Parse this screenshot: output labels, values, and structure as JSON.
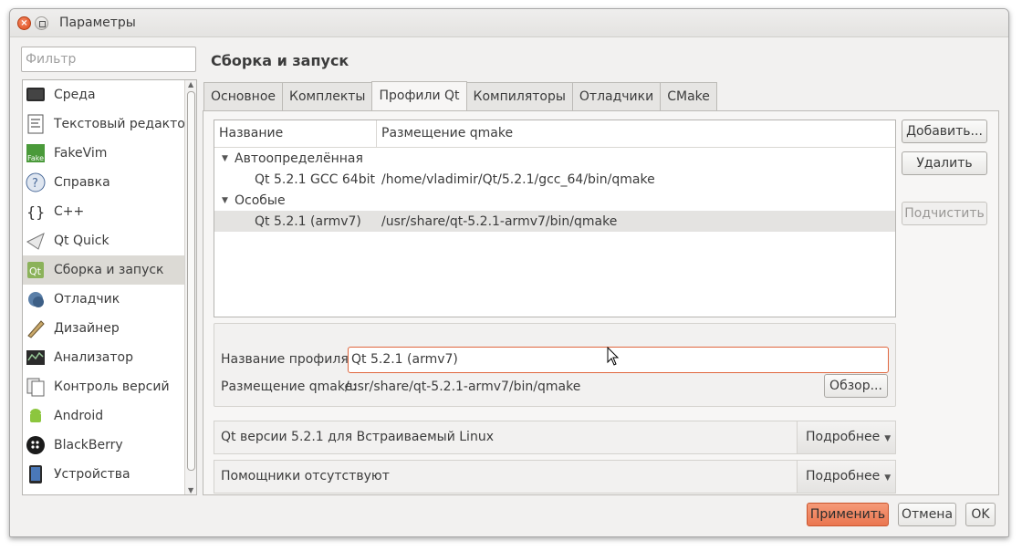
{
  "window": {
    "title": "Параметры"
  },
  "filter": {
    "placeholder": "Фильтр"
  },
  "sidebar": {
    "items": [
      {
        "label": "Среда",
        "icon": "monitor-icon"
      },
      {
        "label": "Текстовый редактор",
        "icon": "text-editor-icon"
      },
      {
        "label": "FakeVim",
        "icon": "fakevim-icon"
      },
      {
        "label": "Справка",
        "icon": "help-icon"
      },
      {
        "label": "C++",
        "icon": "cpp-braces-icon"
      },
      {
        "label": "Qt Quick",
        "icon": "qt-quick-icon"
      },
      {
        "label": "Сборка и запуск",
        "icon": "build-run-icon",
        "active": true
      },
      {
        "label": "Отладчик",
        "icon": "debugger-icon"
      },
      {
        "label": "Дизайнер",
        "icon": "designer-icon"
      },
      {
        "label": "Анализатор",
        "icon": "analyzer-icon"
      },
      {
        "label": "Контроль версий",
        "icon": "version-control-icon"
      },
      {
        "label": "Android",
        "icon": "android-icon"
      },
      {
        "label": "BlackBerry",
        "icon": "blackberry-icon"
      },
      {
        "label": "Устройства",
        "icon": "devices-icon"
      }
    ]
  },
  "page": {
    "title": "Сборка и запуск"
  },
  "tabs": [
    {
      "label": "Основное"
    },
    {
      "label": "Комплекты"
    },
    {
      "label": "Профили Qt",
      "active": true
    },
    {
      "label": "Компиляторы"
    },
    {
      "label": "Отладчики"
    },
    {
      "label": "CMake"
    }
  ],
  "tree": {
    "headers": [
      "Название",
      "Размещение qmake"
    ],
    "groups": [
      {
        "label": "Автоопределённая",
        "rows": [
          {
            "name": "Qt 5.2.1 GCC 64bit",
            "path": "/home/vladimir/Qt/5.2.1/gcc_64/bin/qmake"
          }
        ]
      },
      {
        "label": "Особые",
        "rows": [
          {
            "name": "Qt 5.2.1 (armv7)",
            "path": "/usr/share/qt-5.2.1-armv7/bin/qmake",
            "selected": true
          }
        ]
      }
    ]
  },
  "buttons": {
    "add": "Добавить...",
    "remove": "Удалить",
    "cleanup": "Подчистить",
    "browse": "Обзор...",
    "apply": "Применить",
    "cancel": "Отмена",
    "ok": "OK"
  },
  "details": {
    "profile_name_label": "Название профиля:",
    "profile_name_value": "Qt 5.2.1 (armv7)",
    "qmake_label": "Размещение qmake:",
    "qmake_value": "/usr/share/qt-5.2.1-armv7/bin/qmake"
  },
  "info": {
    "version_text": "Qt версии 5.2.1 для Встраиваемый Linux",
    "helpers_text": "Помощники отсутствуют",
    "more_label": "Подробнее"
  },
  "colors": {
    "accent": "#ea7650",
    "focus_border": "#e0663d",
    "selection": "#dcdad5"
  }
}
